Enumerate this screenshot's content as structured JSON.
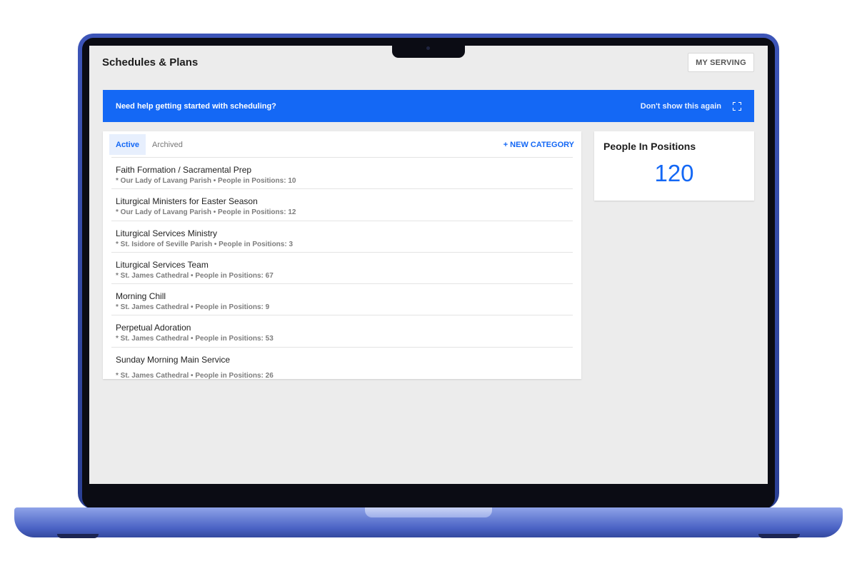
{
  "header": {
    "title": "Schedules & Plans",
    "my_serving_label": "MY SERVING"
  },
  "banner": {
    "text": "Need help getting started with scheduling?",
    "dismiss_label": "Don't show this again",
    "icon": "expand-icon",
    "color": "#1468f5"
  },
  "tabs": [
    {
      "label": "Active",
      "active": true
    },
    {
      "label": "Archived",
      "active": false
    }
  ],
  "new_category_label": "+ NEW CATEGORY",
  "items": [
    {
      "title": "Faith Formation / Sacramental Prep",
      "subtitle": "* Our Lady of Lavang Parish • People in Positions: 10"
    },
    {
      "title": "Liturgical Ministers for Easter Season",
      "subtitle": "* Our Lady of Lavang Parish • People in Positions: 12"
    },
    {
      "title": "Liturgical Services Ministry",
      "subtitle": "* St. Isidore of Seville Parish • People in Positions: 3"
    },
    {
      "title": "Liturgical Services Team",
      "subtitle": "* St. James Cathedral • People in Positions: 67"
    },
    {
      "title": "Morning Chill",
      "subtitle": "* St. James Cathedral • People in Positions: 9"
    },
    {
      "title": "Perpetual Adoration",
      "subtitle": "* St. James Cathedral • People in Positions: 53"
    },
    {
      "title": "Sunday Morning Main Service",
      "subtitle": "* St. James Cathedral • People in Positions: 26"
    }
  ],
  "stats": {
    "label": "People In Positions",
    "value": "120"
  }
}
